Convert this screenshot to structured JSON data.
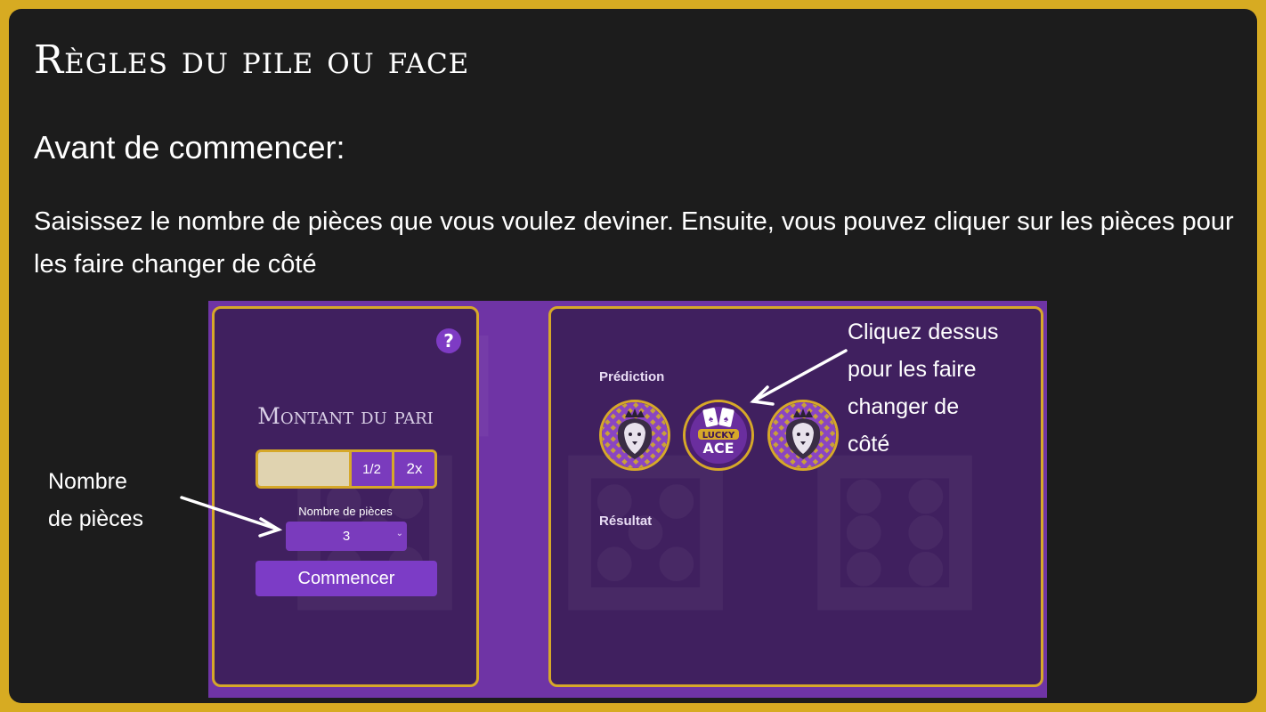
{
  "slide": {
    "title": "Règles du pile ou face",
    "subtitle": "Avant de commencer:",
    "description": "Saisissez le nombre de pièces que vous voulez deviner. Ensuite, vous pouvez cliquer sur les pièces pour les faire changer de côté"
  },
  "game": {
    "help_label": "?",
    "bet_title": "Montant du pari",
    "bet_input_value": "",
    "half_label": "1/2",
    "double_label": "2x",
    "coins_label": "Nombre de pièces",
    "coins_value": "3",
    "start_label": "Commencer",
    "prediction_label": "Prédiction",
    "result_label": "Résultat",
    "coins": [
      {
        "side": "lion-icon"
      },
      {
        "side": "lucky-ace-icon",
        "text_top": "LUCKY",
        "text_bottom": "ACE"
      },
      {
        "side": "lion-icon"
      }
    ],
    "watermark": "LUCKY ACE"
  },
  "annotations": {
    "coins_line1": "Cliquez dessus",
    "coins_line2": "pour les faire",
    "coins_line3": "changer de",
    "coins_line4": "côté",
    "count_line1": "Nombre",
    "count_line2": "de pièces"
  },
  "colors": {
    "frame": "#d7ab22",
    "background": "#1c1c1c",
    "purple": "#6f34a5",
    "panel": "#40205f",
    "gold": "#d6a829"
  }
}
